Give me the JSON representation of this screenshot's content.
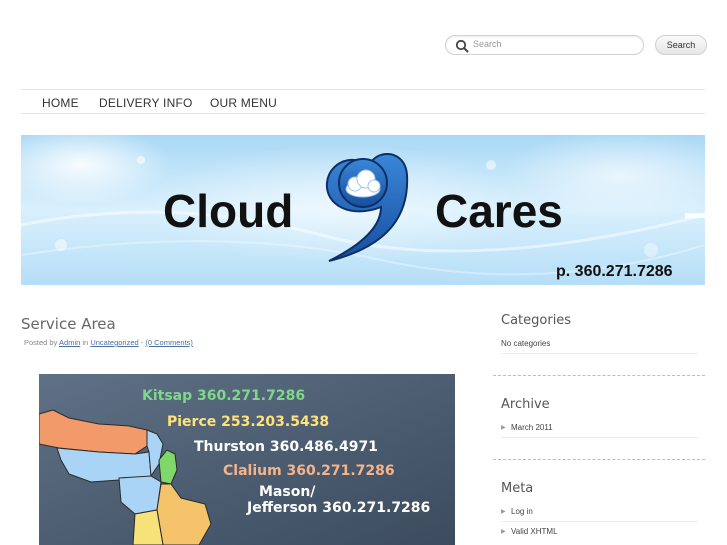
{
  "search": {
    "placeholder": "Search",
    "button_label": "Search"
  },
  "nav": {
    "items": [
      "HOME",
      "DELIVERY INFO",
      "OUR MENU"
    ]
  },
  "banner": {
    "title_left": "Cloud",
    "title_right": "Cares",
    "phone": "p. 360.271.7286"
  },
  "post": {
    "title": "Service Area",
    "meta": {
      "posted_by": "Posted by",
      "author": "Admin",
      "in": "in",
      "category": "Uncategorized",
      "separator": "-",
      "comments": "(0 Comments)"
    },
    "map_labels": [
      {
        "county": "Kitsap 360.271.7286",
        "color": "#7ed88a"
      },
      {
        "county": "Pierce 253.203.5438",
        "color": "#ffe27a"
      },
      {
        "county": "Thurston 360.486.4971",
        "color": "#ffffff"
      },
      {
        "county": "Clalium 360.271.7286",
        "color": "#f7b38a"
      },
      {
        "county": "Mason/",
        "color": "#ffffff"
      },
      {
        "county": "Jefferson 360.271.7286",
        "color": "#ffffff"
      }
    ]
  },
  "sidebar": {
    "categories": {
      "heading": "Categories",
      "empty": "No categories"
    },
    "archive": {
      "heading": "Archive",
      "items": [
        "March 2011"
      ]
    },
    "meta": {
      "heading": "Meta",
      "items": [
        "Log in",
        "Valid XHTML"
      ]
    }
  },
  "colors": {
    "nav_text": "#333333",
    "link": "#4a6fa5",
    "banner_sky": "#bfe3fa"
  }
}
